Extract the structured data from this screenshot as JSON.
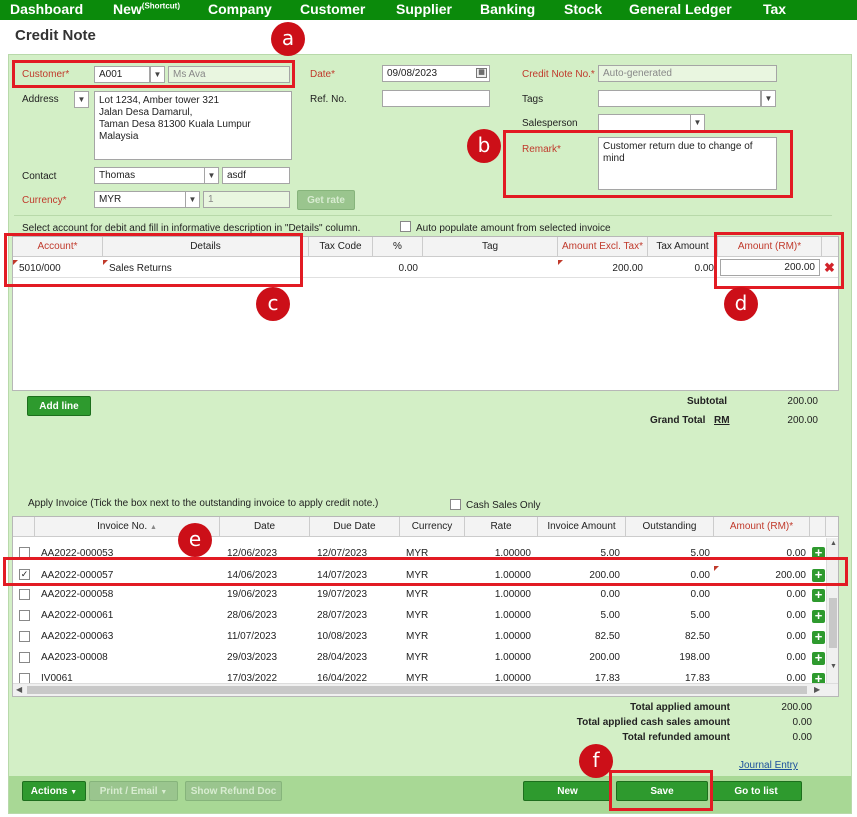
{
  "nav": {
    "dashboard": "Dashboard",
    "new": "New",
    "new_sup": "(Shortcut)",
    "company": "Company",
    "customer": "Customer",
    "supplier": "Supplier",
    "banking": "Banking",
    "stock": "Stock",
    "general_ledger": "General Ledger",
    "tax": "Tax"
  },
  "page_title": "Credit Note",
  "markers": {
    "a": "a",
    "b": "b",
    "c": "c",
    "d": "d",
    "e": "e",
    "f": "f"
  },
  "form": {
    "customer_label": "Customer*",
    "customer_code": "A001",
    "customer_name": "Ms Ava",
    "address_label": "Address",
    "address_lines": [
      "Lot 1234, Amber tower 321",
      "Jalan Desa Damarul,",
      "Taman Desa 81300 Kuala Lumpur",
      "Malaysia"
    ],
    "contact_label": "Contact",
    "contact_name": "Thomas",
    "contact_extra": "asdf",
    "currency_label": "Currency*",
    "currency": "MYR",
    "rate": "1",
    "get_rate": "Get rate",
    "date_label": "Date*",
    "date": "09/08/2023",
    "ref_label": "Ref. No.",
    "ref_value": "",
    "cn_no_label": "Credit Note No.*",
    "cn_no": "Auto-generated",
    "tags_label": "Tags",
    "salesperson_label": "Salesperson",
    "remark_label": "Remark*",
    "remark": "Customer return due to change of mind"
  },
  "details": {
    "instruction": "Select account for debit and fill in informative description in \"Details\" column.",
    "auto_populate_label": "Auto populate amount from selected invoice",
    "headers": [
      "Account*",
      "Details",
      "Tax Code",
      "%",
      "Tag",
      "Amount Excl. Tax*",
      "Tax Amount",
      "Amount (RM)*"
    ],
    "row": {
      "account": "5010/000",
      "details": "Sales Returns",
      "tax_code": "",
      "percent": "0.00",
      "tag": "",
      "amount_excl": "200.00",
      "tax_amount": "0.00",
      "amount": "200.00"
    },
    "add_line": "Add line",
    "subtotal_label": "Subtotal",
    "subtotal": "200.00",
    "grand_total_label": "Grand Total",
    "grand_total_currency": "RM",
    "grand_total": "200.00"
  },
  "apply": {
    "instruction": "Apply Invoice (Tick the box next to the outstanding invoice to apply credit note.)",
    "cash_sales_label": "Cash Sales Only",
    "headers": [
      "Invoice No.",
      "Date",
      "Due Date",
      "Currency",
      "Rate",
      "Invoice Amount",
      "Outstanding",
      "Amount (RM)*"
    ],
    "rows": [
      {
        "checked": false,
        "invoice": "AA2022-000053",
        "date": "12/06/2023",
        "due": "12/07/2023",
        "currency": "MYR",
        "rate": "1.00000",
        "amount": "5.00",
        "outstanding": "5.00",
        "applied": "0.00"
      },
      {
        "checked": true,
        "invoice": "AA2022-000057",
        "date": "14/06/2023",
        "due": "14/07/2023",
        "currency": "MYR",
        "rate": "1.00000",
        "amount": "200.00",
        "outstanding": "0.00",
        "applied": "200.00"
      },
      {
        "checked": false,
        "invoice": "AA2022-000058",
        "date": "19/06/2023",
        "due": "19/07/2023",
        "currency": "MYR",
        "rate": "1.00000",
        "amount": "0.00",
        "outstanding": "0.00",
        "applied": "0.00"
      },
      {
        "checked": false,
        "invoice": "AA2022-000061",
        "date": "28/06/2023",
        "due": "28/07/2023",
        "currency": "MYR",
        "rate": "1.00000",
        "amount": "5.00",
        "outstanding": "5.00",
        "applied": "0.00"
      },
      {
        "checked": false,
        "invoice": "AA2022-000063",
        "date": "11/07/2023",
        "due": "10/08/2023",
        "currency": "MYR",
        "rate": "1.00000",
        "amount": "82.50",
        "outstanding": "82.50",
        "applied": "0.00"
      },
      {
        "checked": false,
        "invoice": "AA2023-00008",
        "date": "29/03/2023",
        "due": "28/04/2023",
        "currency": "MYR",
        "rate": "1.00000",
        "amount": "200.00",
        "outstanding": "198.00",
        "applied": "0.00"
      },
      {
        "checked": false,
        "invoice": "IV0061",
        "date": "17/03/2022",
        "due": "16/04/2022",
        "currency": "MYR",
        "rate": "1.00000",
        "amount": "17.83",
        "outstanding": "17.83",
        "applied": "0.00"
      }
    ],
    "total_applied_label": "Total applied amount",
    "total_applied": "200.00",
    "total_cash_label": "Total applied cash sales amount",
    "total_cash": "0.00",
    "total_refunded_label": "Total refunded amount",
    "total_refunded": "0.00",
    "journal_entry": "Journal Entry"
  },
  "footer": {
    "actions": "Actions",
    "print_email": "Print / Email",
    "show_refund": "Show Refund Doc",
    "new": "New",
    "save": "Save",
    "go_to_list": "Go to list"
  }
}
